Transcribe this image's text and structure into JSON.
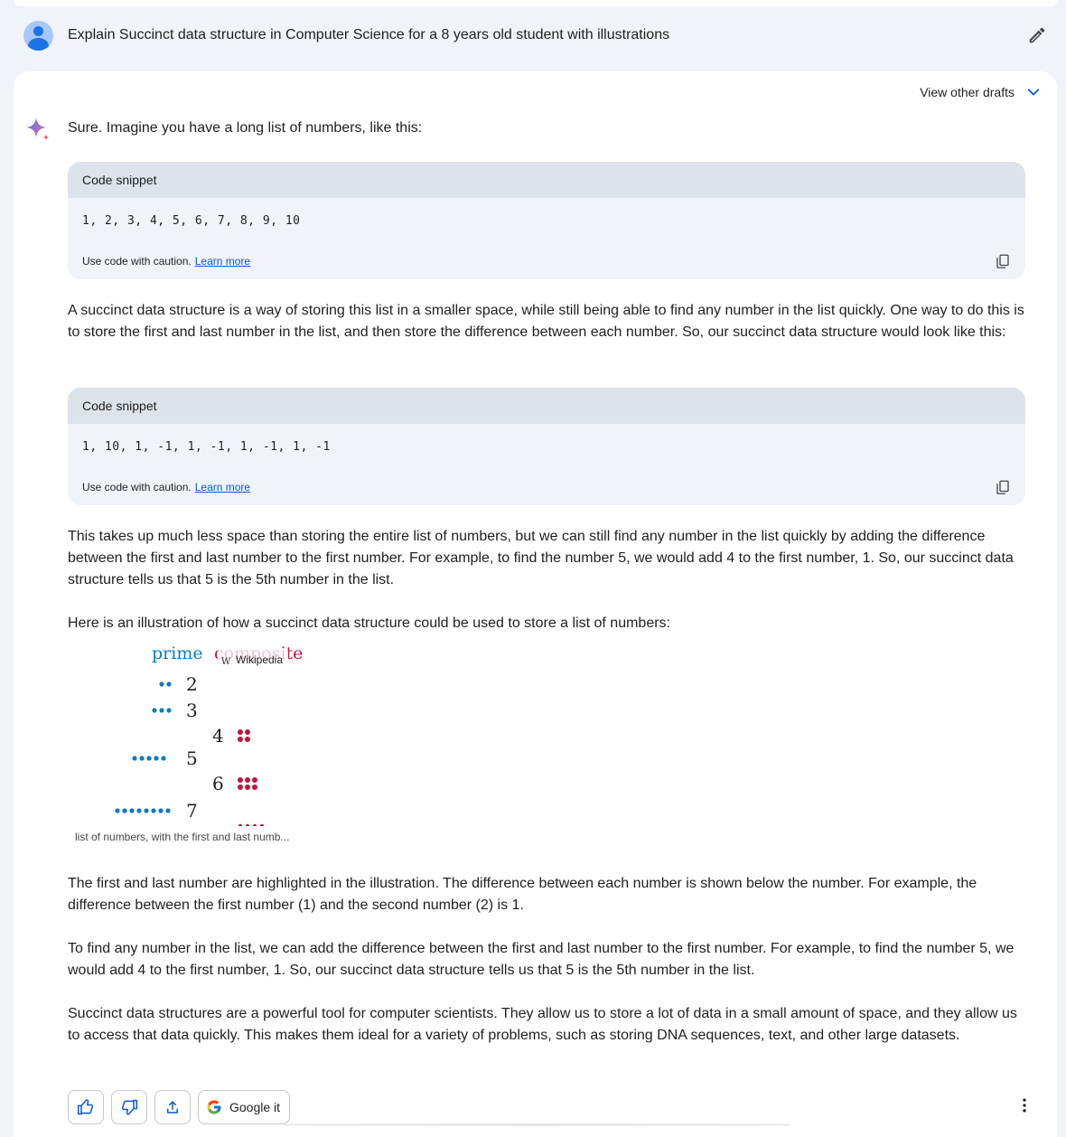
{
  "prompt": {
    "text": "Explain Succinct data structure in Computer Science for a 8 years old student with illustrations"
  },
  "header": {
    "view_drafts_label": "View other drafts"
  },
  "response": {
    "intro": "Sure. Imagine you have a long list of numbers, like this:",
    "code_blocks": [
      {
        "header": "Code snippet",
        "code": "1, 2, 3, 4, 5, 6, 7, 8, 9, 10",
        "caution": "Use code with caution.",
        "learn_more": "Learn more"
      },
      {
        "header": "Code snippet",
        "code": "1, 10, 1, -1, 1, -1, 1, -1, 1, -1",
        "caution": "Use code with caution.",
        "learn_more": "Learn more"
      }
    ],
    "para1": "A succinct data structure is a way of storing this list in a smaller space, while still being able to find any number in the list quickly. One way to do this is to store the first and last number in the list, and then store the difference between each number. So, our succinct data structure would look like this:",
    "para2": "This takes up much less space than storing the entire list of numbers, but we can still find any number in the list quickly by adding the difference between the first and last number to the first number. For example, to find the number 5, we would add 4 to the first number, 1. So, our succinct data structure tells us that 5 is the 5th number in the list.",
    "para3": "Here is an illustration of how a succinct data structure could be used to store a list of numbers:",
    "illustration": {
      "label_prime": "prime",
      "label_composite": "composite",
      "source": "Wikipedia",
      "source_glyph": "W",
      "numbers": [
        "2",
        "3",
        "4",
        "5",
        "6",
        "7"
      ],
      "caption": "list of numbers, with the first and last numb..."
    },
    "para4": "The first and last number are highlighted in the illustration. The difference between each number is shown below the number. For example, the difference between the first number (1) and the second number (2) is 1.",
    "para5": "To find any number in the list, we can add the difference between the first and last number to the first number. For example, to find the number 5, we would add 4 to the first number, 1. So, our succinct data structure tells us that 5 is the 5th number in the list.",
    "para6": "Succinct data structures are a powerful tool for computer scientists. They allow us to store a lot of data in a small amount of space, and they allow us to access that data quickly. This makes them ideal for a variety of problems, such as storing DNA sequences, text, and other large datasets."
  },
  "actions": {
    "google_label": "Google it"
  },
  "colors": {
    "accent_blue": "#0b57d0",
    "prime_blue": "#0b7bc0",
    "composite_red": "#c0143c"
  },
  "icons": [
    "avatar",
    "pencil-icon",
    "chevron-down-icon",
    "sparkle-icon",
    "copy-icon",
    "thumbs-up-icon",
    "thumbs-down-icon",
    "share-icon",
    "google-logo-icon",
    "more-vert-icon"
  ]
}
